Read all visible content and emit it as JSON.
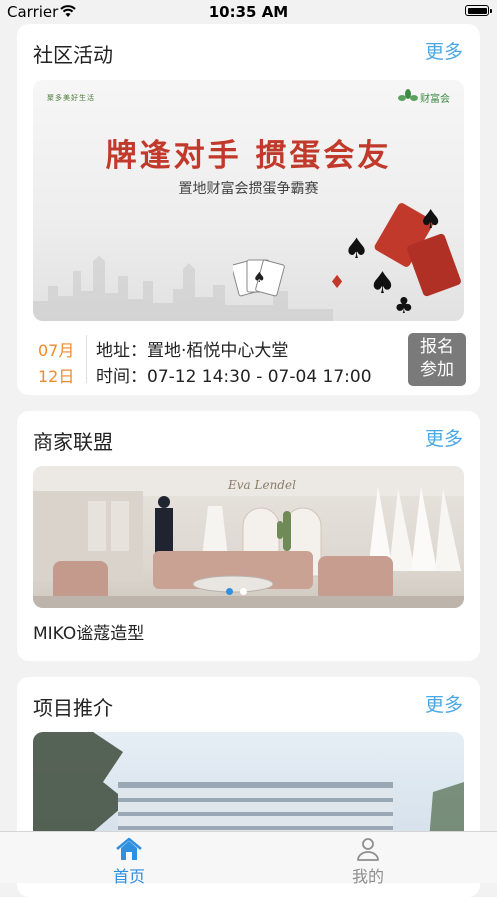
{
  "status_bar": {
    "carrier": "Carrier",
    "time": "10:35 AM"
  },
  "community": {
    "title": "社区活动",
    "more": "更多",
    "banner": {
      "logo_left": "聚多美好生活",
      "logo_right": "财富会",
      "headline": "牌逢对手 掼蛋会友",
      "subline": "置地财富会掼蛋争霸赛"
    },
    "event": {
      "month": "07月",
      "day": "12日",
      "address": "地址：置地·栢悦中心大堂",
      "time": "时间：07-12 14:30 - 07-04 17:00",
      "signup_line1": "报名",
      "signup_line2": "参加"
    }
  },
  "merchants": {
    "title": "商家联盟",
    "more": "更多",
    "banner_sign": "Eva Lendel",
    "name": "MIKO谧蔻造型",
    "slides": {
      "total": 2,
      "active": 1
    }
  },
  "projects": {
    "title": "项目推介",
    "more": "更多"
  },
  "tabs": [
    {
      "label": "首页",
      "icon": "home-icon",
      "active": true
    },
    {
      "label": "我的",
      "icon": "profile-icon",
      "active": false
    }
  ],
  "colors": {
    "accent": "#4aa8e6",
    "tab_active": "#2f8fe0",
    "tab_inactive": "#8e8e8e",
    "date_orange": "#f08a2c",
    "headline_red": "#c0392b",
    "button_gray": "#7a7a7a"
  }
}
